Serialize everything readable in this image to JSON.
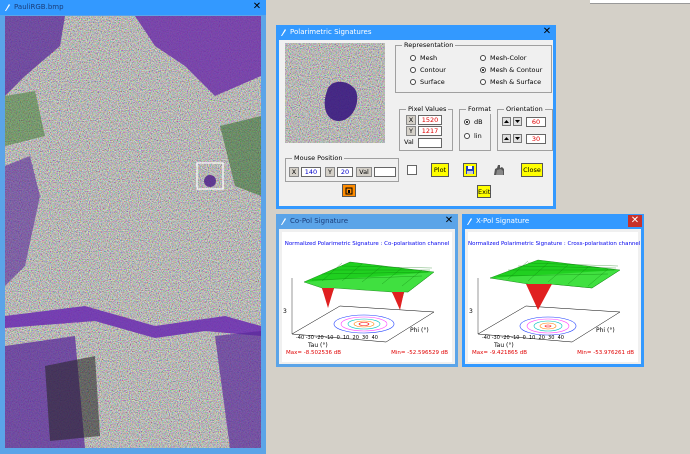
{
  "image_window": {
    "title": "PauliRGB.bmp",
    "colors": {
      "titlebar": "#3399ff",
      "frame": "#5ba4e8",
      "selection": "#ffffff"
    }
  },
  "polsig_window": {
    "title": "Polarimetric Signatures",
    "representation": {
      "label": "Representation",
      "options": [
        "Mesh",
        "Contour",
        "Surface",
        "Mesh-Color",
        "Mesh & Contour",
        "Mesh & Surface"
      ],
      "selected": "Mesh & Contour"
    },
    "pixel_values": {
      "label": "Pixel Values",
      "x_label": "X",
      "x_value": "1520",
      "y_label": "Y",
      "y_value": "1217",
      "val_label": "Val",
      "val_value": ""
    },
    "format": {
      "label": "Format",
      "options": [
        "dB",
        "lin"
      ],
      "selected": "dB"
    },
    "orientation": {
      "label": "Orientation",
      "value1": "60",
      "value2": "30"
    },
    "mouse_position": {
      "label": "Mouse Position",
      "x_label": "X",
      "x_value": "140",
      "y_label": "Y",
      "y_value": "20",
      "val_label": "Val",
      "val_value": ""
    },
    "buttons": {
      "plot": "Plot",
      "close": "Close",
      "exit": "Exit"
    }
  },
  "copol_window": {
    "title": "Co-Pol Signature",
    "plot_title": "Normalized Polarimetric Signature : Co-polarisation channel",
    "axis_x": "Phi (°)",
    "axis_y": "Tau (°)",
    "ticks": "-40 -30 -20 -10  0  10  20  30  40",
    "max": "Max= -8.502536 dB",
    "min": "Min= -52.596529 dB"
  },
  "xpol_window": {
    "title": "X-Pol Signature",
    "plot_title": "Normalized Polarimetric Signature : Cross-polarisation channel",
    "axis_x": "Phi (°)",
    "axis_y": "Tau (°)",
    "ticks": "-40 -30 -20 -10  0  10  20  30  40",
    "max": "Max= -9.421865 dB",
    "min": "Min= -53.976261 dB"
  }
}
